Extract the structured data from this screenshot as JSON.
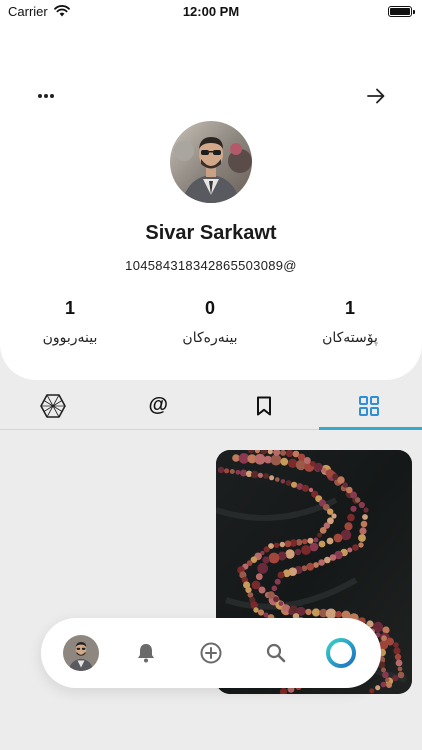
{
  "status_bar": {
    "carrier": "Carrier",
    "time": "12:00 PM"
  },
  "profile": {
    "name": "Sivar Sarkawt",
    "handle": "104584318342865503089@",
    "stats": {
      "followers": {
        "value": "1",
        "label": "بینەربوون"
      },
      "following": {
        "value": "0",
        "label": "بینەرەکان"
      },
      "posts": {
        "value": "1",
        "label": "پۆستەکان"
      }
    }
  },
  "tabs": [
    {
      "icon": "hexagon-grid-icon",
      "active": false
    },
    {
      "icon": "mention-icon",
      "label": "@",
      "active": false
    },
    {
      "icon": "bookmark-icon",
      "active": false
    },
    {
      "icon": "grid-icon",
      "active": true
    }
  ],
  "bottom_nav": [
    {
      "icon": "avatar"
    },
    {
      "icon": "bell-icon"
    },
    {
      "icon": "plus-circle-icon"
    },
    {
      "icon": "search-icon"
    },
    {
      "icon": "app-ring-icon"
    }
  ],
  "colors": {
    "accent": "#3aa8c8",
    "grid_icon": "#2f8fd6",
    "background": "#ececec",
    "card": "#ffffff"
  }
}
